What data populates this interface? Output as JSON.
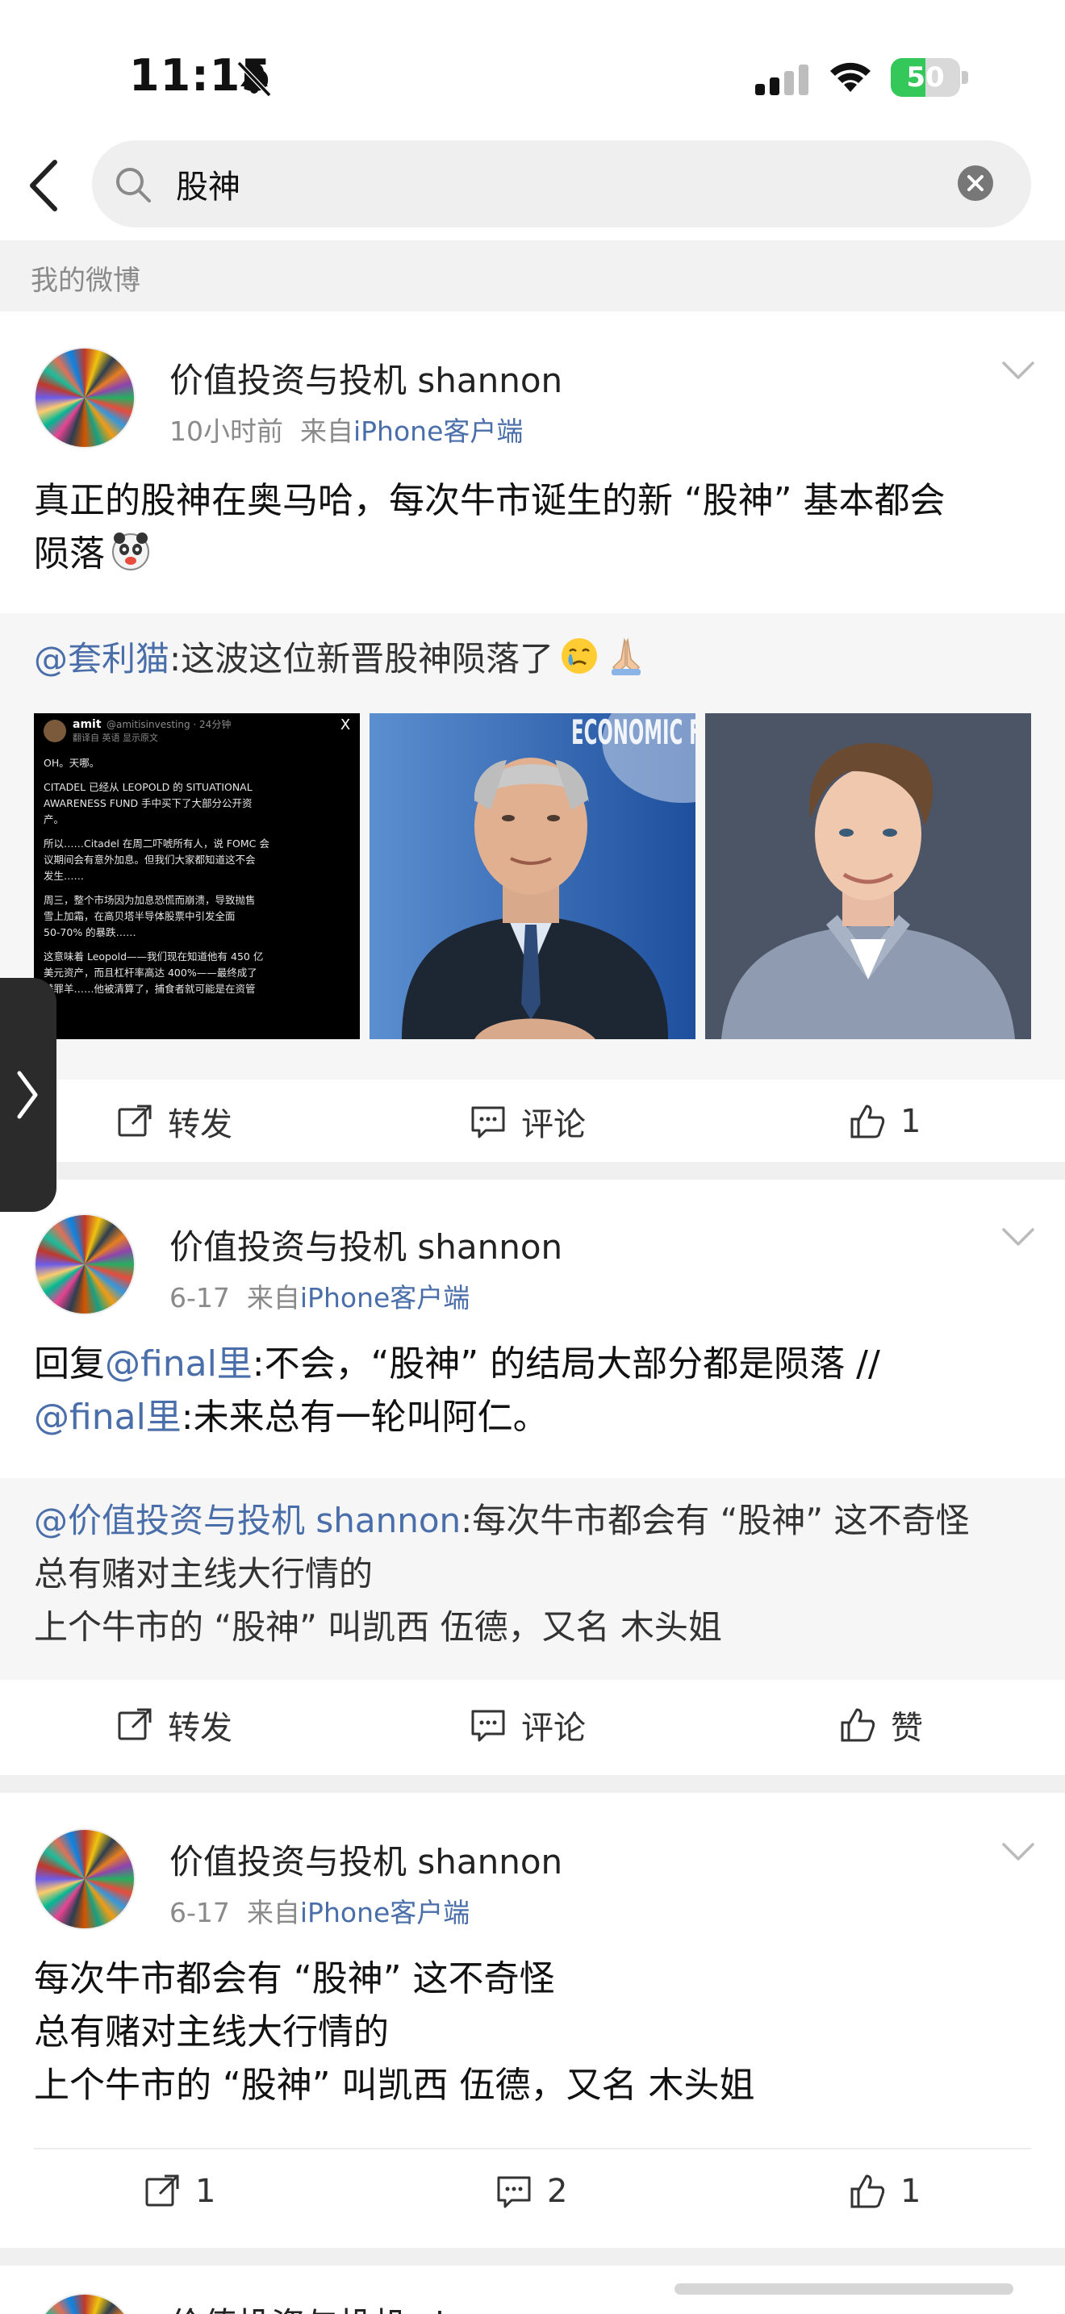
{
  "status": {
    "time": "11:15",
    "battery": "50",
    "battery_level": 0.5
  },
  "search": {
    "query": "股神"
  },
  "section_title": "我的微博",
  "posts": [
    {
      "author": "价值投资与投机 shannon",
      "time": "10小时前",
      "from_prefix": "来自",
      "source": "iPhone客户端",
      "text_line1": "真正的股神在奥马哈，每次牛市诞生的新 “股神” 基本都会",
      "text_line2": "陨落",
      "repost_mention": "@套利猫",
      "repost_text": ":这波这位新晋股神陨落了",
      "images": [
        {
          "kind": "tweet-screenshot",
          "user": "amit",
          "handle": "@amitisinvesting · 24分钟",
          "sub": "翻译自 英语  显示原文",
          "lines": [
            "OH。天哪。",
            "CITADEL 已经从 LEOPOLD 的 SITUATIONAL",
            "AWARENESS FUND 手中买下了大部分公开资",
            "产。",
            "所以……Citadel 在周二吓唬所有人，说 FOMC 会",
            "议期间会有意外加息。但我们大家都知道这不会",
            "发生……",
            "周三，整个市场因为加息恐慌而崩溃，导致抛售",
            "雪上加霜，在高贝塔半导体股票中引发全面",
            "50-70% 的暴跌……",
            "这意味着 Leopold——我们现在知道他有 450 亿",
            "美元资产，而且杠杆率高达 400%——最终成了",
            "替罪羊……他被清算了，捕食者就可能是在资管"
          ]
        },
        {
          "kind": "photo-man-econ-forum",
          "banner": "ECONOMIC FORUM"
        },
        {
          "kind": "photo-young-man"
        }
      ],
      "actions": {
        "repost": "转发",
        "comment": "评论",
        "like": "1"
      }
    },
    {
      "author": "价值投资与投机 shannon",
      "time": "6-17",
      "from_prefix": "来自",
      "source": "iPhone客户端",
      "reply_prefix": "回复",
      "mention1": "@final里",
      "text_a": ":不会，“股神” 的结局大部分都是陨落 //",
      "mention2": "@final里",
      "text_b": ":未来总有一轮叫阿仁。",
      "repost_mention": "@价值投资与投机 shannon",
      "repost_line1": ":每次牛市都会有 “股神” 这不奇怪",
      "repost_line2": "总有赌对主线大行情的",
      "repost_line3": "上个牛市的 “股神” 叫凯西 伍德，又名 木头姐",
      "actions": {
        "repost": "转发",
        "comment": "评论",
        "like": "赞"
      }
    },
    {
      "author": "价值投资与投机 shannon",
      "time": "6-17",
      "from_prefix": "来自",
      "source": "iPhone客户端",
      "line1": "每次牛市都会有 “股神” 这不奇怪",
      "line2": "总有赌对主线大行情的",
      "line3": "上个牛市的 “股神” 叫凯西 伍德，又名 木头姐",
      "actions": {
        "repost": "1",
        "comment": "2",
        "like": "1"
      }
    },
    {
      "author": "价值投资与投机 sh"
    }
  ],
  "colors": {
    "link": "#4a6ea9",
    "divider": "#f0f0f0",
    "battery_green": "#34c759"
  }
}
